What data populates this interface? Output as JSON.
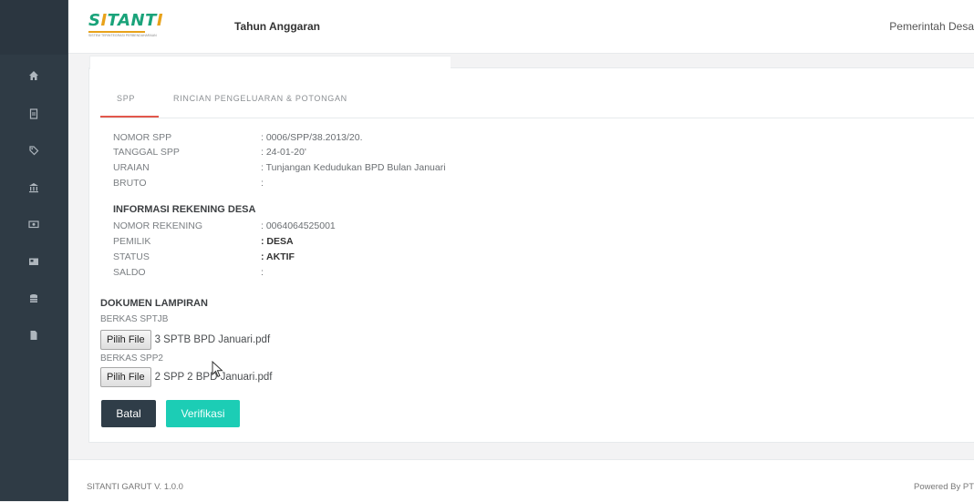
{
  "app": {
    "logo_text": "SITANTI",
    "logo_subtext": "SISTEM TERINTEGRASI PERBENDAHARAAN",
    "tahun_anggaran_label": "Tahun Anggaran",
    "pemerintah_label": "Pemerintah Desa"
  },
  "sidebar": {
    "items": [
      {
        "icon": "home-icon"
      },
      {
        "icon": "document-icon"
      },
      {
        "icon": "tag-icon"
      },
      {
        "icon": "bank-icon"
      },
      {
        "icon": "money-icon"
      },
      {
        "icon": "card-icon"
      },
      {
        "icon": "database-icon"
      },
      {
        "icon": "file-icon"
      }
    ]
  },
  "tabs": [
    {
      "label": "SPP",
      "active": true
    },
    {
      "label": "RINCIAN PENGELUARAN & POTONGAN",
      "active": false
    }
  ],
  "spp": {
    "nomor_label": "NOMOR SPP",
    "nomor_value": ": 0006/SPP/38.2013/20.",
    "tanggal_label": "TANGGAL SPP",
    "tanggal_value": ": 24-01-20'",
    "uraian_label": "URAIAN",
    "uraian_value": ": Tunjangan Kedudukan BPD Bulan Januari",
    "bruto_label": "BRUTO",
    "bruto_value": ":"
  },
  "rekening": {
    "title": "INFORMASI REKENING DESA",
    "nomor_label": "NOMOR REKENING",
    "nomor_value": ": 0064064525001",
    "pemilik_label": "PEMILIK",
    "pemilik_value": ": DESA",
    "status_label": "STATUS",
    "status_value": ": AKTIF",
    "saldo_label": "SALDO",
    "saldo_value": ":"
  },
  "lampiran": {
    "title": "DOKUMEN LAMPIRAN",
    "sptjb_label": "BERKAS SPTJB",
    "sptjb_button": "Pilih File",
    "sptjb_file": "3 SPTB  BPD Januari.pdf",
    "spp2_label": "BERKAS SPP2",
    "spp2_button": "Pilih File",
    "spp2_file": "2 SPP 2 BPD Januari.pdf"
  },
  "actions": {
    "batal_label": "Batal",
    "verifikasi_label": "Verifikasi"
  },
  "footer": {
    "version": "SITANTI GARUT V. 1.0.0",
    "powered": "Powered By PT"
  },
  "colors": {
    "sidebar": "#2f3b45",
    "accent_tab": "#e2574c",
    "verifikasi": "#1ccdb5",
    "batal": "#2f3d48"
  }
}
